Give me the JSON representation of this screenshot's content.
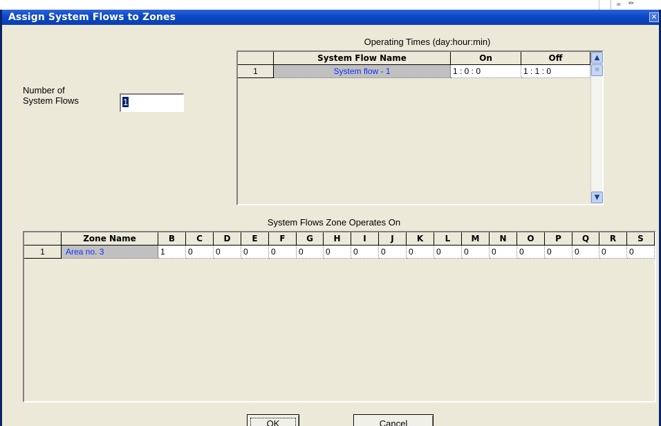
{
  "window": {
    "title": "Assign System Flows to Zones"
  },
  "left_panel": {
    "number_label": "Number of\nSystem Flows",
    "number_value": "1"
  },
  "operating_times": {
    "caption": "Operating Times (day:hour:min)",
    "columns": [
      "System Flow Name",
      "On",
      "Off"
    ],
    "rows": [
      {
        "index": "1",
        "name": "System flow - 1",
        "on": "1 : 0 : 0",
        "off": "1 : 1 : 0"
      }
    ]
  },
  "zones": {
    "caption": "System Flows Zone Operates On",
    "columns": [
      "Zone Name",
      "B",
      "C",
      "D",
      "E",
      "F",
      "G",
      "H",
      "I",
      "J",
      "K",
      "L",
      "M",
      "N",
      "O",
      "P",
      "Q",
      "R",
      "S"
    ],
    "rows": [
      {
        "index": "1",
        "name": "Area no.  3",
        "values": [
          "1",
          "0",
          "0",
          "0",
          "0",
          "0",
          "0",
          "0",
          "0",
          "0",
          "0",
          "0",
          "0",
          "0",
          "0",
          "0",
          "0",
          "0"
        ]
      }
    ]
  },
  "buttons": {
    "ok": "OK",
    "cancel": "Cancel"
  },
  "colors": {
    "title_bar": "#0a48c8",
    "name_text": "#1030ff",
    "face": "#ece9d8"
  },
  "icons": [
    "close-icon",
    "scroll-up-arrow-icon",
    "scroll-down-arrow-icon",
    "scroll-thumb-grip-icon"
  ]
}
